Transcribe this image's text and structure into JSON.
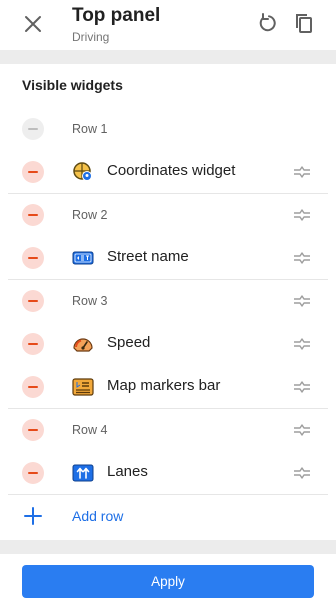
{
  "header": {
    "title": "Top panel",
    "subtitle": "Driving",
    "close_icon": "close-icon",
    "reset_icon": "reset-icon",
    "copy_icon": "copy-icon"
  },
  "section": {
    "title": "Visible widgets"
  },
  "rows": [
    {
      "label": "Row 1",
      "disabled": true
    },
    {
      "widget": "Coordinates widget",
      "icon": "coordinates-icon"
    },
    {
      "label": "Row 2"
    },
    {
      "widget": "Street name",
      "icon": "street-name-icon"
    },
    {
      "label": "Row 3"
    },
    {
      "widget": "Speed",
      "icon": "speed-icon"
    },
    {
      "widget": "Map markers bar",
      "icon": "map-markers-icon"
    },
    {
      "label": "Row 4"
    },
    {
      "widget": "Lanes",
      "icon": "lanes-icon"
    }
  ],
  "add_row": {
    "label": "Add row"
  },
  "apply": {
    "label": "Apply"
  },
  "colors": {
    "accent": "#2a7df1",
    "remove": "#e64a19",
    "remove_bg": "#fbd9d3"
  }
}
